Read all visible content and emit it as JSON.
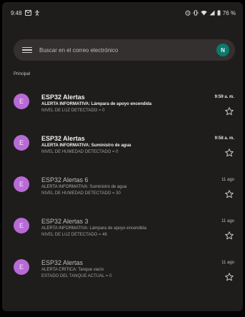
{
  "status_bar": {
    "time": "9:48",
    "left_icons": [
      "gmail-notification-icon",
      "accessibility-icon"
    ],
    "right_icons": [
      "alarm-icon",
      "vibrate-icon",
      "wifi-icon",
      "signal-icon",
      "battery-icon"
    ],
    "battery": "76 %"
  },
  "search": {
    "placeholder": "Buscar en el correo electrónico",
    "account_initial": "N"
  },
  "folder": {
    "label": "Principal"
  },
  "emails": [
    {
      "initial": "E",
      "sender": "ESP32 Alertas",
      "subject": "ALERTA INFORMATIVA: Lámpara de apoyo encendida",
      "snippet": "NIVEL DE LUZ DETECTADO = 0",
      "time": "9:59 a. m.",
      "unread": true
    },
    {
      "initial": "E",
      "sender": "ESP32 Alertas",
      "subject": "ALERTA INFORMATIVA: Suministro de agua",
      "snippet": "NIVEL DE HUMEDAD DETECTADO = 0",
      "time": "9:58 a. m.",
      "unread": true
    },
    {
      "initial": "E",
      "sender": "ESP32 Alertas 6",
      "subject": "ALERTA INFORMATIVA: Suministro de agua",
      "snippet": "NIVEL DE HUMEDAD DETECTADO = 30",
      "time": "11 ago",
      "unread": false
    },
    {
      "initial": "E",
      "sender": "ESP32 Alertas 3",
      "subject": "ALERTA INFORMATIVA: Lámpara de apoyo encendida",
      "snippet": "NIVEL DE LUZ DETECTADO = 46",
      "time": "11 ago",
      "unread": false
    },
    {
      "initial": "E",
      "sender": "ESP32 Alertas",
      "subject": "ALERTA CRÍTICA: Tanque vacío",
      "snippet": "ESTADO DEL TANQUE ACTUAL = 0",
      "time": "11 ago",
      "unread": false
    }
  ]
}
